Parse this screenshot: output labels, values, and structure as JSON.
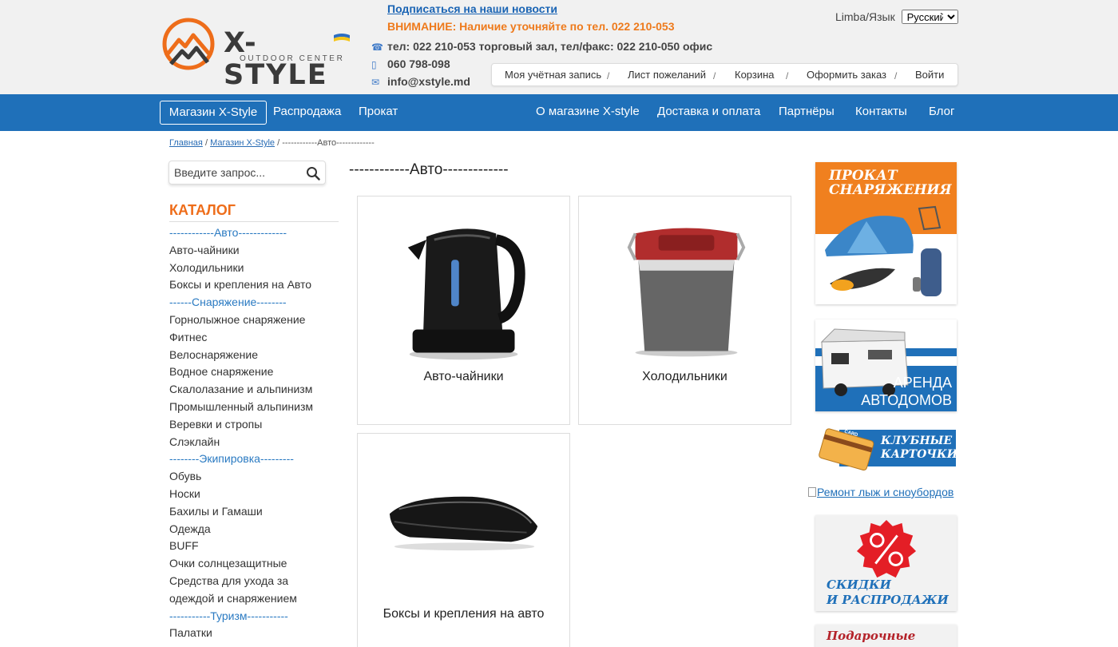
{
  "header": {
    "brand": "X-STYLE",
    "brand_sub": "OUTDOOR CENTER",
    "subscribe": "Подписаться на наши новости",
    "warning": "ВНИМАНИЕ: Наличие уточняйте по тел. 022 210-053",
    "phone_line": "тел: 022 210-053 торговый зал, тел/факс: 022 210-050 офис",
    "mobile": "060 798-098",
    "email": "info@xstyle.md",
    "lang_label": "Limba/Язык",
    "lang_selected": "Русский"
  },
  "account_bar": {
    "items": [
      "Моя учётная запись",
      "Лист пожеланий",
      "Корзина",
      "Оформить заказ",
      "Войти"
    ],
    "separator": "/"
  },
  "nav": {
    "left": [
      "Магазин X-Style",
      "Распродажа",
      "Прокат"
    ],
    "right": [
      "О магазине X-style",
      "Доставка и оплата",
      "Партнёры",
      "Контакты",
      "Блог"
    ]
  },
  "breadcrumb": {
    "home": "Главная",
    "shop": "Магазин X-Style",
    "current": "------------Авто-------------",
    "separator": "/"
  },
  "search": {
    "placeholder": "Введите запрос..."
  },
  "catalog": {
    "title": "КАТАЛОГ",
    "items": [
      {
        "label": "------------Авто-------------",
        "category": true
      },
      {
        "label": "Авто-чайники",
        "category": false
      },
      {
        "label": "Холодильники",
        "category": false
      },
      {
        "label": "Боксы и крепления на Авто",
        "category": false
      },
      {
        "label": "------Снаряжение--------",
        "category": true
      },
      {
        "label": "Горнолыжное снаряжение",
        "category": false
      },
      {
        "label": "Фитнес",
        "category": false
      },
      {
        "label": "Велоснаряжение",
        "category": false
      },
      {
        "label": "Водное снаряжение",
        "category": false
      },
      {
        "label": "Скалолазание и альпинизм",
        "category": false
      },
      {
        "label": "Промышленный альпинизм",
        "category": false
      },
      {
        "label": "Веревки и стропы",
        "category": false
      },
      {
        "label": "Слэклайн",
        "category": false
      },
      {
        "label": "--------Экипировка---------",
        "category": true
      },
      {
        "label": "Обувь",
        "category": false
      },
      {
        "label": "Носки",
        "category": false
      },
      {
        "label": "Бахилы и Гамаши",
        "category": false
      },
      {
        "label": "Одежда",
        "category": false
      },
      {
        "label": "BUFF",
        "category": false
      },
      {
        "label": "Очки солнцезащитные",
        "category": false
      },
      {
        "label": "Средства для ухода за",
        "category": false
      },
      {
        "label": "одеждой и снаряжением",
        "category": false
      },
      {
        "label": "-----------Туризм-----------",
        "category": true
      },
      {
        "label": "Палатки",
        "category": false
      }
    ]
  },
  "main": {
    "title": "------------Авто-------------",
    "products": [
      "Авто-чайники",
      "Холодильники",
      "Боксы и крепления на авто"
    ]
  },
  "banners": {
    "rental": [
      "ПРОКАТ",
      "СНАРЯЖЕНИЯ"
    ],
    "motorhome": [
      "АРЕНДА",
      "АВТОДОМОВ"
    ],
    "club": [
      "КЛУБНЫЕ",
      "КАРТОЧКИ"
    ],
    "club_card_text": "CARD",
    "repair_link": "Ремонт лыж и сноубордов",
    "discounts": [
      "СКИДКИ",
      "И РАСПРОДАЖИ"
    ],
    "gift": "Подарочные"
  },
  "colors": {
    "nav_blue": "#1f70b9",
    "orange": "#ee6d1a",
    "link_blue": "#1a64b4"
  }
}
